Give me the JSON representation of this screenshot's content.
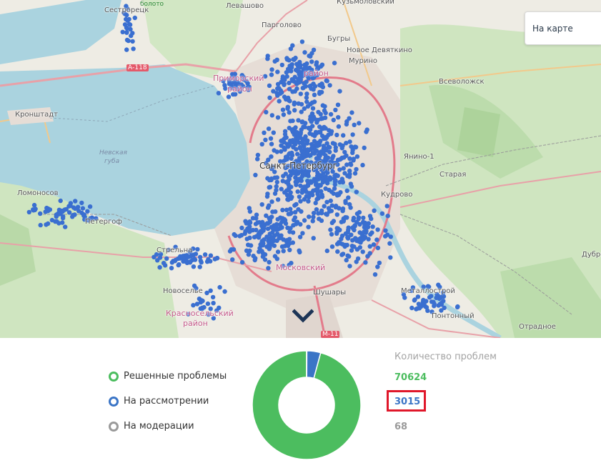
{
  "map": {
    "labels": {
      "sestroretsk": "Сестрорецк",
      "boloto": "болото",
      "levashovo": "Левашово",
      "kuzmolovsky": "Кузьмоловский",
      "pargolovo": "Парголово",
      "bugry": "Бугры",
      "novoe_devyatkino": "Новое Девяткино",
      "murino": "Мурино",
      "vsevolozhsk": "Всеволожск",
      "primorsky": "Приморский",
      "rayon": "район",
      "rayon2": "район",
      "kronshtadt": "Кронштадт",
      "nevskaya": "Невская",
      "guba": "губа",
      "spb": "Санкт-Петербург",
      "yanino": "Янино-1",
      "staraya": "Старая",
      "kudrovo": "Кудрово",
      "lomonosov": "Ломоносов",
      "petergof": "Петергоф",
      "strelna": "Стрельна",
      "moskovsky": "Московский",
      "novoselye": "Новоселье",
      "krasnoselsky": "Красносельский",
      "rayon3": "район",
      "shushary": "Шушары",
      "metallostroy": "Металлострой",
      "pontonny": "Понтонный",
      "otradnoe": "Отрадное",
      "dubrovka": "Дубро",
      "a118": "А-118",
      "m11": "М-11"
    }
  },
  "view_toggle": {
    "label": "На карте"
  },
  "legend": {
    "resolved": "Решенные проблемы",
    "in_review": "На рассмотрении",
    "moderation": "На модерации"
  },
  "counts": {
    "title": "Количество проблем",
    "resolved": "70624",
    "in_review": "3015",
    "moderation": "68"
  },
  "colors": {
    "resolved": "#4cbd5f",
    "in_review": "#3b75c6",
    "moderation": "#9a9a9a",
    "highlight": "#e0172a",
    "point": "#3a6fd0"
  },
  "icons": {
    "chevron": "chevron-down-icon"
  }
}
